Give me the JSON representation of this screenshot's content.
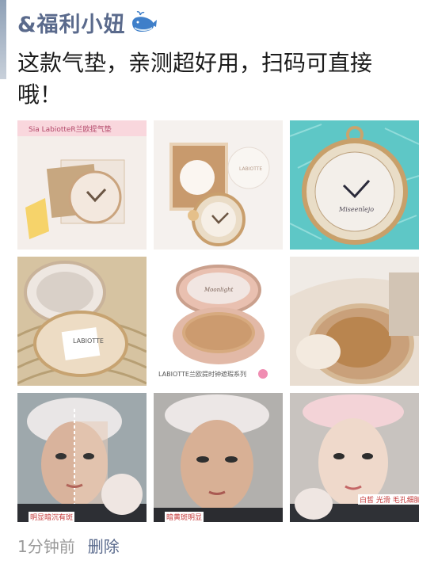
{
  "post": {
    "username": "&福利小妞",
    "text_line1": "这款气垫，亲测超好用，扫码可直接",
    "text_line2": "哦！",
    "time": "1分钟前",
    "delete_label": "删除"
  },
  "images": [
    {
      "tag": "Sia LabiotteR兰欧提气垫"
    },
    {
      "tag": ""
    },
    {
      "tag": ""
    },
    {
      "tag": "LABIOTTE"
    },
    {
      "tag": "LABIOTTE兰欧提时钟遮瑕系列"
    },
    {
      "tag": ""
    },
    {
      "tag": "明显暗沉有斑"
    },
    {
      "tag": "暗黄斑明显"
    },
    {
      "tag": "白皙 光滑 毛孔细腻"
    }
  ]
}
